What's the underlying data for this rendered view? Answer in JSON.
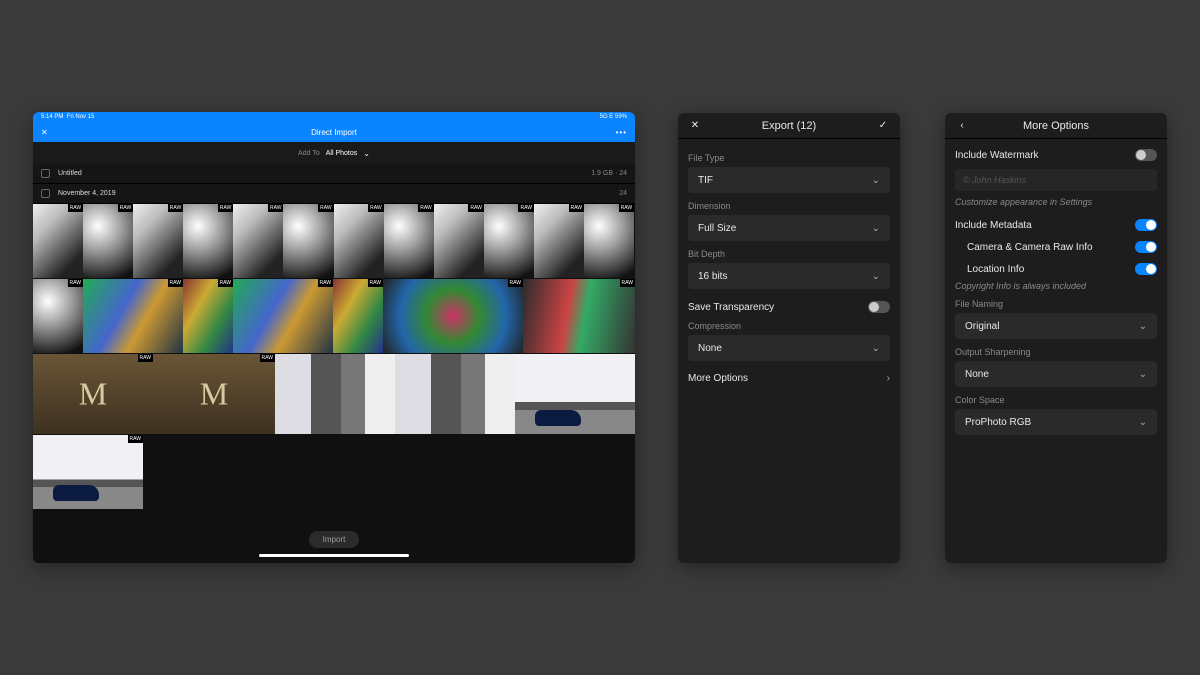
{
  "import": {
    "status_time": "5:14 PM",
    "status_date": "Fri Nov 15",
    "status_right": "5G E  59%",
    "title": "Direct Import",
    "addto_label": "Add To",
    "addto_value": "All Photos",
    "untitled_label": "Untitled",
    "untitled_right": "1.9 GB · 24",
    "date_label": "November 4, 2019",
    "date_right": "24",
    "raw_badge": "RAW",
    "import_button": "Import"
  },
  "export": {
    "title": "Export (12)",
    "file_type_label": "File Type",
    "file_type_value": "TIF",
    "dimension_label": "Dimension",
    "dimension_value": "Full Size",
    "bitdepth_label": "Bit Depth",
    "bitdepth_value": "16 bits",
    "save_transparency": "Save Transparency",
    "compression_label": "Compression",
    "compression_value": "None",
    "more_options": "More Options"
  },
  "more": {
    "title": "More Options",
    "include_watermark": "Include Watermark",
    "watermark_placeholder": "© John Haskins",
    "watermark_hint": "Customize appearance in Settings",
    "include_metadata": "Include Metadata",
    "camera_info": "Camera & Camera Raw Info",
    "location_info": "Location Info",
    "copyright_hint": "Copyright Info is always included",
    "file_naming_label": "File Naming",
    "file_naming_value": "Original",
    "output_sharpening_label": "Output Sharpening",
    "output_sharpening_value": "None",
    "color_space_label": "Color Space",
    "color_space_value": "ProPhoto RGB"
  }
}
